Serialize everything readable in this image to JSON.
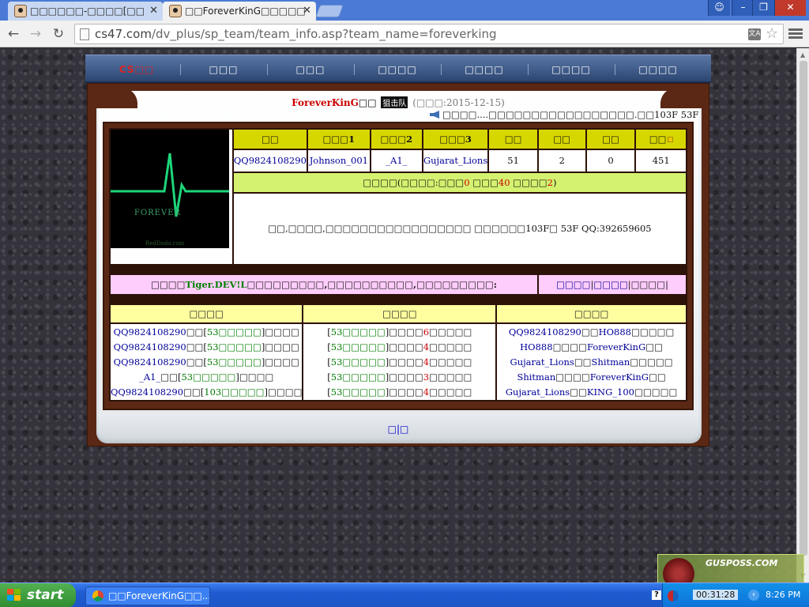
{
  "browser": {
    "tabs": [
      {
        "title": "□□□□□□-□□□□[□□"
      },
      {
        "title": "□□ForeverKinG□□□□□"
      }
    ],
    "url_domain": "cs47.com",
    "url_path": "/dv_plus/sp_team/team_info.asp?team_name=foreverking",
    "translate_label": "文A"
  },
  "site_nav": {
    "items": [
      "CS□□",
      "□□□",
      "□□□",
      "□□□□",
      "□□□□",
      "□□□□",
      "□□□□"
    ]
  },
  "team": {
    "name": "ForeverKinG",
    "name_suffix": "□□",
    "badge": "狙击队",
    "founded": "(□□□:2015-12-15)",
    "marquee": "□□□□....□□□□□□□□□□□□□□□□□.□□103F 53F",
    "logo_word": "FOREVER",
    "logo_site": "RedDodo.com"
  },
  "members_table": {
    "headers": [
      "□□",
      "□□□1",
      "□□□2",
      "□□□3",
      "□□",
      "□□",
      "□□",
      "□□"
    ],
    "row": [
      "QQ9824108290",
      "Johnson_001",
      "_A1_",
      "Gujarat_Lions",
      "51",
      "2",
      "0",
      "451"
    ],
    "stats_line": {
      "prefix": "□□□□(□□□□:□□□",
      "v1": "0",
      "mid1": " □□□",
      "v2": "40",
      "mid2": " □□□□",
      "v3": "2",
      "suffix": ")"
    },
    "announcement": "□□,□□□□,□□□□□□□□□□□□□□□□□ □□□□□□103F□ 53F QQ:392659605"
  },
  "promo": {
    "prefix": "□□□□",
    "highlight": "Tiger.DEV!L",
    "suffix": "□□□□□□□□□,□□□□□□□□□□,□□□□□□□□□:",
    "links": [
      "□□□□",
      "□□□□",
      "□□□□"
    ]
  },
  "records": {
    "headers": [
      "□□□□",
      "□□□□",
      "□□□□"
    ],
    "col1": [
      {
        "a": "QQ9824108290",
        "b": "□□[",
        "c": "53□□□□□",
        "d": "]□□□□"
      },
      {
        "a": "QQ9824108290",
        "b": "□□[",
        "c": "53□□□□□",
        "d": "]□□□□"
      },
      {
        "a": "QQ9824108290",
        "b": "□□[",
        "c": "53□□□□□",
        "d": "]□□□□"
      },
      {
        "a": "_A1_",
        "b": "□□[",
        "c": "53□□□□□",
        "d": "]□□□□"
      },
      {
        "a": "QQ9824108290",
        "b": "□□[",
        "c": "103□□□□□",
        "d": "]□□□□"
      }
    ],
    "col2": [
      {
        "a": "[",
        "b": "53□□□□□",
        "c": "]□□□□",
        "n": "6",
        "d": "□□□□□"
      },
      {
        "a": "[",
        "b": "53□□□□□",
        "c": "]□□□□",
        "n": "4",
        "d": "□□□□□"
      },
      {
        "a": "[",
        "b": "53□□□□□",
        "c": "]□□□□",
        "n": "4",
        "d": "□□□□□"
      },
      {
        "a": "[",
        "b": "53□□□□□",
        "c": "]□□□□",
        "n": "3",
        "d": "□□□□□"
      },
      {
        "a": "[",
        "b": "53□□□□□",
        "c": "]□□□□",
        "n": "4",
        "d": "□□□□□"
      }
    ],
    "col3": [
      {
        "a": "QQ9824108290",
        "b": "□□",
        "c": "HO888",
        "d": "□□□□□"
      },
      {
        "a": "HO888",
        "b": "□□□□",
        "c": "ForeverKinG",
        "d": "□□"
      },
      {
        "a": "Gujarat_Lions",
        "b": "□□",
        "c": "Shitman",
        "d": "□□□□□"
      },
      {
        "a": "Shitman",
        "b": "□□□□",
        "c": "ForeverKinG",
        "d": "□□"
      },
      {
        "a": "Gujarat_Lions",
        "b": "□□",
        "c": "KING_100",
        "d": "□□□□□"
      }
    ]
  },
  "pager": {
    "prev": "□",
    "sep": "|",
    "next": "□"
  },
  "taskbar": {
    "start": "start",
    "task_title": "□□ForeverKinG□□...",
    "help": "?",
    "clock_inner": "00:31:28",
    "clock": "8:26 PM",
    "watermark": "GUSPOSS.COM"
  },
  "colors": {
    "accent_red": "#cc0000",
    "header_yellow": "#d7d700",
    "lime": "#d4f26f",
    "pink": "#ffcdfb",
    "frame_brown": "#5a2814"
  }
}
